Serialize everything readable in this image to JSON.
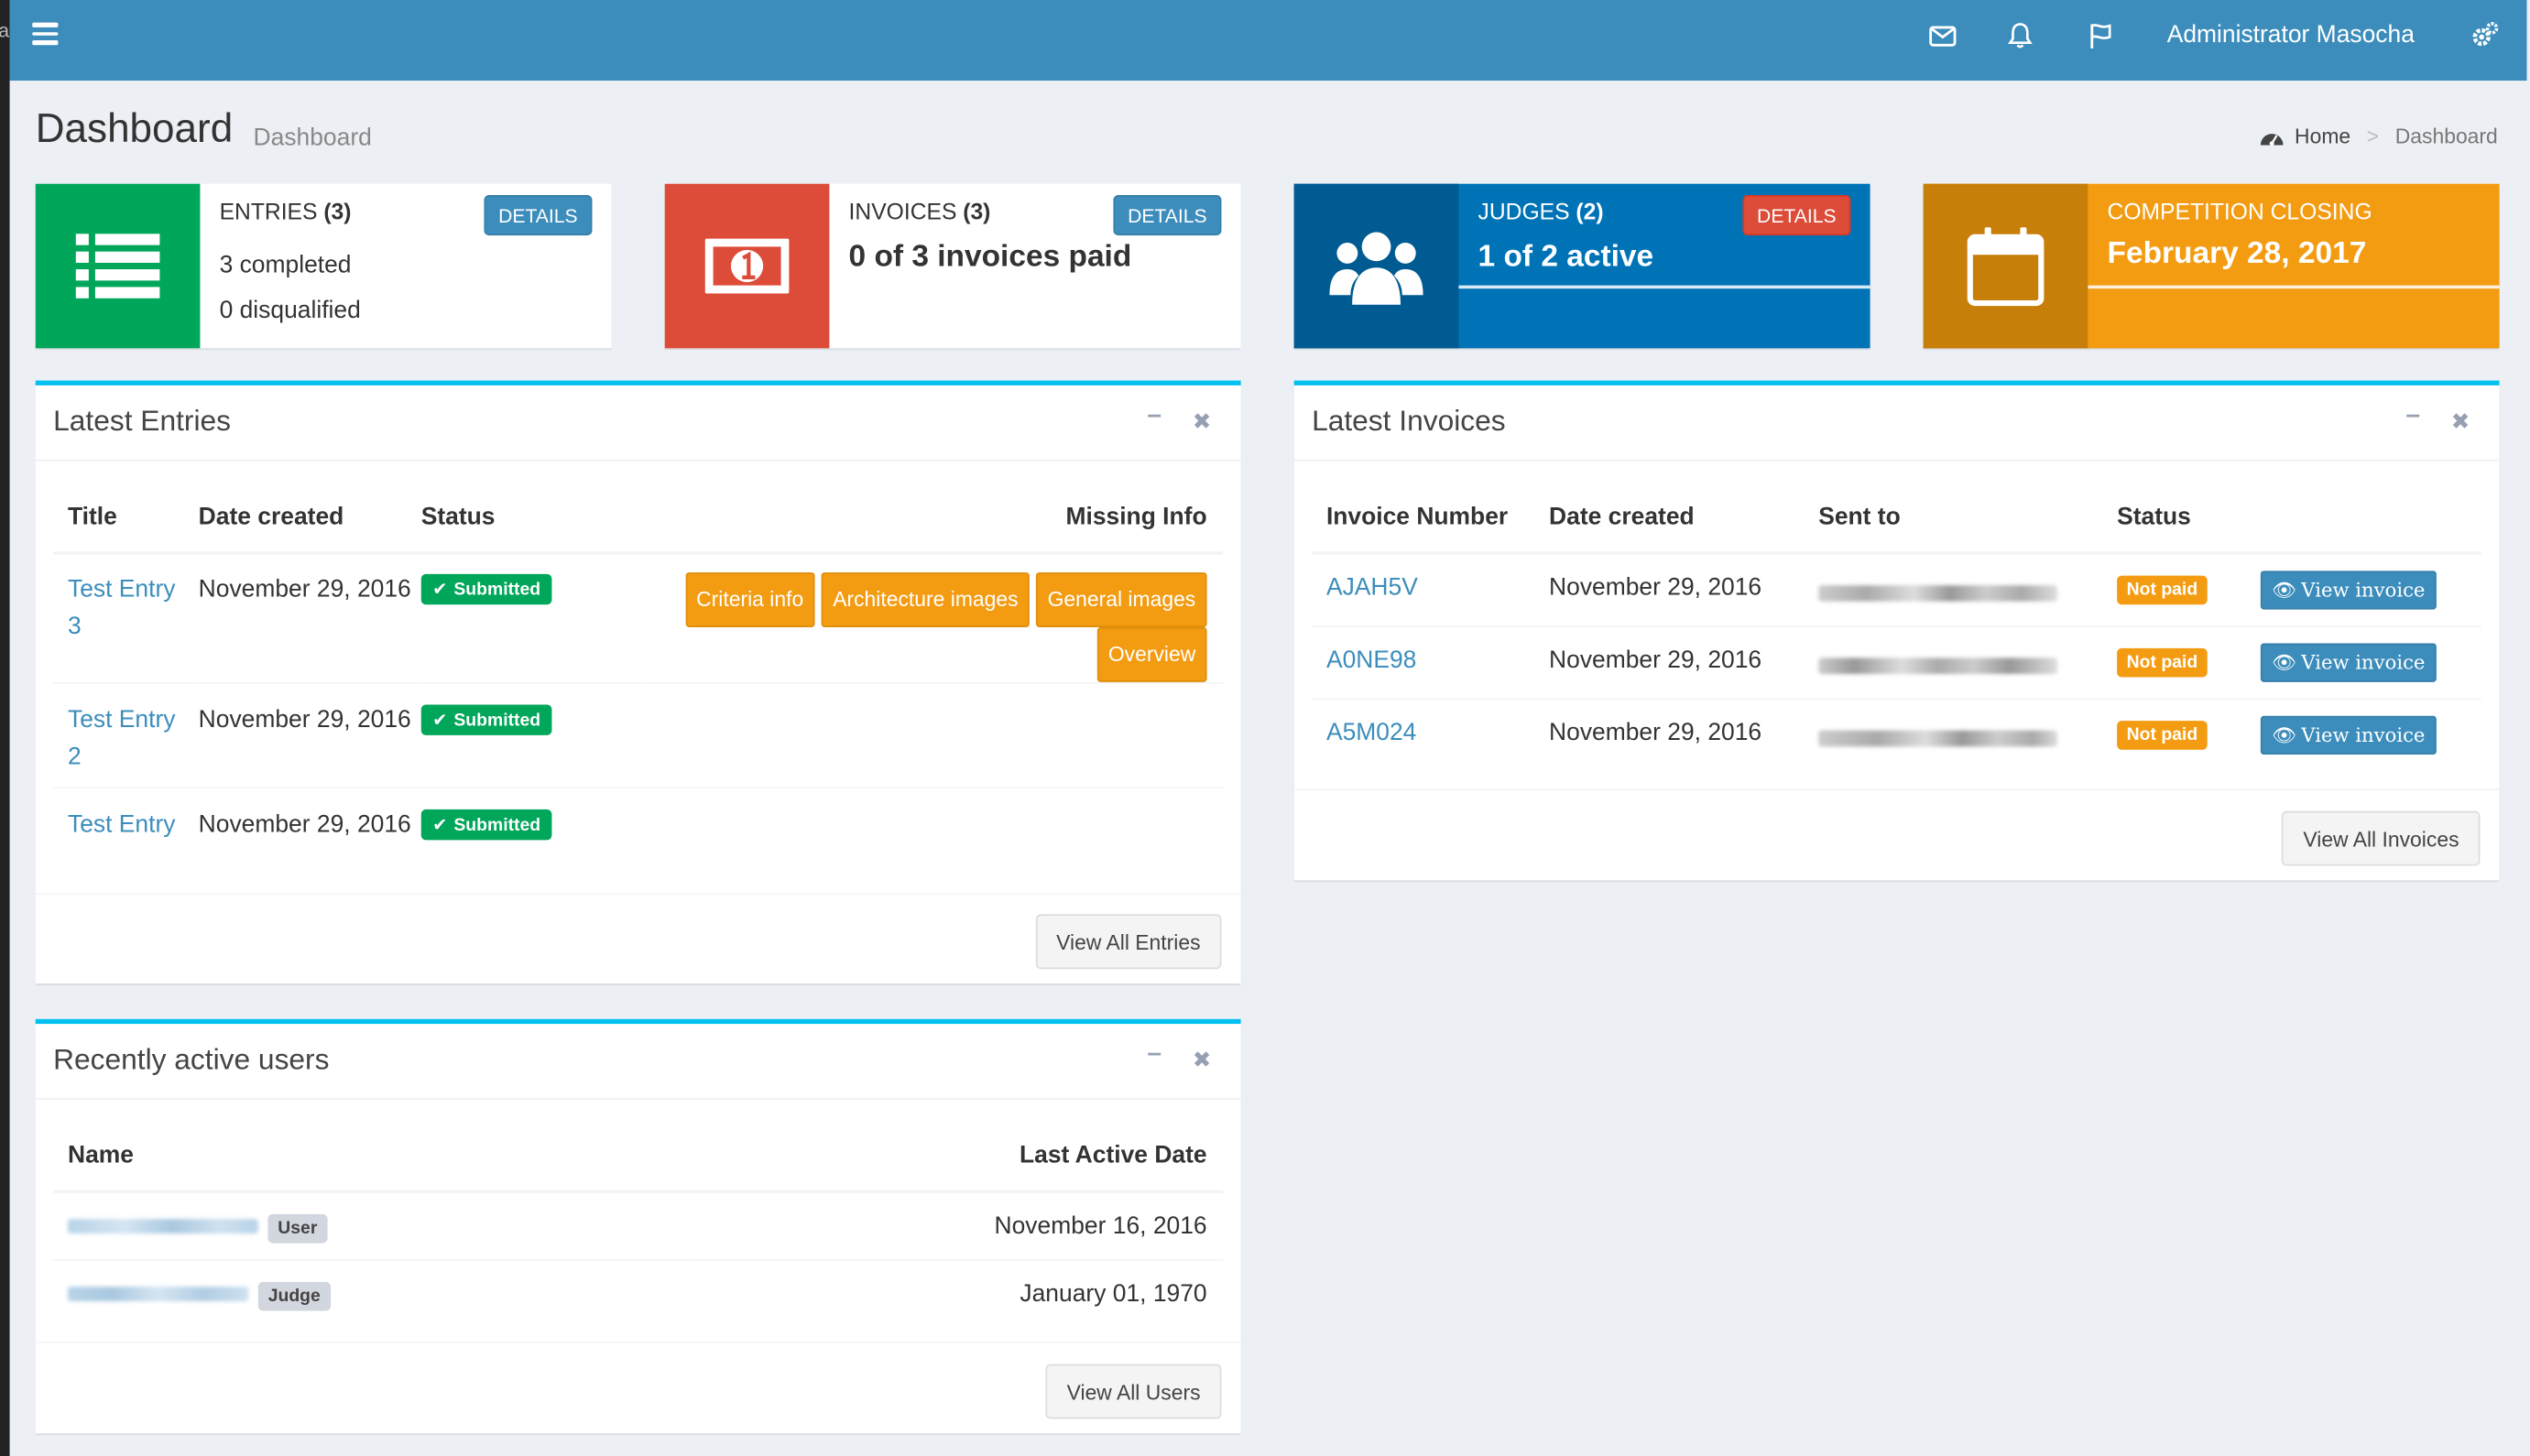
{
  "topbar": {
    "user_name": "Administrator Masocha",
    "icons": [
      "menu-icon",
      "envelope-icon",
      "bell-icon",
      "flag-icon",
      "gears-icon"
    ]
  },
  "header": {
    "title": "Dashboard",
    "subtitle": "Dashboard",
    "breadcrumb": {
      "home": "Home",
      "current": "Dashboard"
    }
  },
  "info_boxes": {
    "entries": {
      "label": "ENTRIES",
      "count": "(3)",
      "line1": "3 completed",
      "line2": "0 disqualified",
      "button": "DETAILS",
      "color": "#00a65a"
    },
    "invoices": {
      "label": "INVOICES",
      "count": "(3)",
      "value": "0 of 3 invoices paid",
      "button": "DETAILS",
      "color": "#dd4b39"
    },
    "judges": {
      "label": "JUDGES",
      "count": "(2)",
      "value": "1 of 2 active",
      "button": "DETAILS",
      "color": "#0073b7"
    },
    "competition": {
      "label": "COMPETITION CLOSING",
      "value": "February 28, 2017",
      "color": "#f39c12"
    }
  },
  "latest_entries": {
    "title": "Latest Entries",
    "columns": {
      "title": "Title",
      "date": "Date created",
      "status": "Status",
      "missing": "Missing Info"
    },
    "rows": [
      {
        "title": "Test Entry 3",
        "date": "November 29, 2016",
        "status": "Submitted",
        "missing": [
          "Criteria info",
          "Architecture images",
          "General images",
          "Overview"
        ]
      },
      {
        "title": "Test Entry 2",
        "date": "November 29, 2016",
        "status": "Submitted",
        "missing": []
      },
      {
        "title": "Test Entry",
        "date": "November 29, 2016",
        "status": "Submitted",
        "missing": []
      }
    ],
    "footer_button": "View All Entries"
  },
  "latest_invoices": {
    "title": "Latest Invoices",
    "columns": {
      "number": "Invoice Number",
      "date": "Date created",
      "sent_to": "Sent to",
      "status": "Status"
    },
    "rows": [
      {
        "number": "AJAH5V",
        "date": "November 29, 2016",
        "status": "Not paid",
        "action": "View invoice"
      },
      {
        "number": "A0NE98",
        "date": "November 29, 2016",
        "status": "Not paid",
        "action": "View invoice"
      },
      {
        "number": "A5M024",
        "date": "November 29, 2016",
        "status": "Not paid",
        "action": "View invoice"
      }
    ],
    "footer_button": "View All Invoices"
  },
  "recent_users": {
    "title": "Recently active users",
    "columns": {
      "name": "Name",
      "last_active": "Last Active Date"
    },
    "rows": [
      {
        "role": "User",
        "date": "November 16, 2016"
      },
      {
        "role": "Judge",
        "date": "January 01, 1970"
      }
    ],
    "footer_button": "View All Users"
  }
}
